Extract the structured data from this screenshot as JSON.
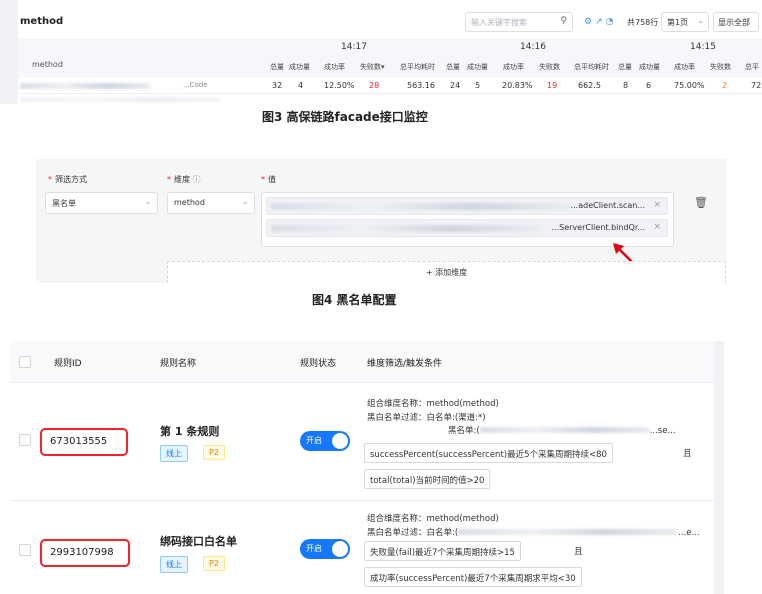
{
  "panel1": {
    "title": "method",
    "search_placeholder": "输入关键字搜索",
    "search_icon": "search-icon",
    "total": "共758行",
    "page_select": "第1页",
    "show_all": "显示全部",
    "method_header": "method",
    "times": [
      "14:17",
      "14:16",
      "14:15"
    ],
    "columns": [
      "总量",
      "成功量",
      "成功率",
      "失败数▾",
      "总平均耗时",
      "总量",
      "成功量",
      "成功率",
      "失败数",
      "总平均耗时",
      "总量",
      "成功量",
      "成功率",
      "失败数",
      "总平"
    ],
    "row_method_suffix": "...Code",
    "row": [
      "32",
      "4",
      "12.50%",
      "28",
      "563.16",
      "24",
      "5",
      "20.83%",
      "19",
      "662.5",
      "8",
      "6",
      "75.00%",
      "2",
      "72"
    ]
  },
  "caption3": "图3 高保链路facade接口监控",
  "panel2": {
    "label_filter": "筛选方式",
    "label_dimension": "维度",
    "label_value": "值",
    "filter_value": "黑名单",
    "dimension_value": "method",
    "value_tag1": "...adeClient.scan...",
    "value_tag2": "...ServerClient.bindQr...",
    "add_dimension": "+  添加维度"
  },
  "caption4": "图4 黑名单配置",
  "panel3": {
    "headers": [
      "规则ID",
      "规则名称",
      "规则状态",
      "维度筛选/触发条件"
    ],
    "rows": [
      {
        "id": "673013555",
        "name": "第 1 条规则",
        "tag_online": "线上",
        "tag_priority": "P2",
        "status": "开启",
        "line1": "组合维度名称：method(method)",
        "line2": "黑白名单过滤：白名单:(渠道:*)",
        "line3": "黑名单:(",
        "line3_tail": "...se...",
        "cond1": "successPercent(successPercent)最近5个采集周期持续<80",
        "cond1_and": "且",
        "cond2": "total(total)当前时间的值>20"
      },
      {
        "id": "2993107998",
        "name": "绑码接口白名单",
        "tag_online": "线上",
        "tag_priority": "P2",
        "status": "开启",
        "line1": "组合维度名称：method(method)",
        "line2": "黑白名单过滤：白名单:(",
        "line2_tail": "...e...",
        "cond1": "失败量(fail)最近7个采集周期持续>15",
        "cond1_and": "且",
        "cond2": "成功率(successPercent)最近7个采集周期求平均<30"
      }
    ]
  },
  "colors": {
    "primary": "#1677ff",
    "danger": "#f5222d",
    "warning": "#fa8c16"
  }
}
